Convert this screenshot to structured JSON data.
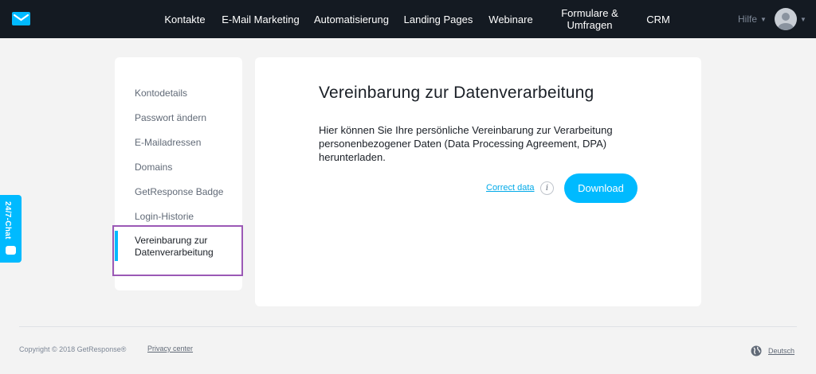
{
  "colors": {
    "topbar": "#141a22",
    "accent": "#00baff",
    "highlight": "#9b59b6",
    "link": "#00a9e8"
  },
  "header": {
    "logo_icon": "envelope-logo-icon",
    "nav": [
      "Kontakte",
      "E-Mail Marketing",
      "Automatisierung",
      "Landing Pages",
      "Webinare",
      "Formulare &\nUmfragen",
      "CRM"
    ],
    "help_label": "Hilfe",
    "avatar_icon": "user-avatar-icon"
  },
  "sidebar": {
    "items": [
      "Kontodetails",
      "Passwort ändern",
      "E-Mailadressen",
      "Domains",
      "GetResponse Badge",
      "Login-Historie"
    ],
    "active_item": "Vereinbarung zur\nDatenverarbeitung"
  },
  "main": {
    "title": "Vereinbarung zur Datenverarbeitung",
    "description": "Hier können Sie Ihre persönliche Vereinbarung zur Verarbeitung personenbezogener Daten (Data Processing Agreement, DPA) herunterladen.",
    "correct_data_link": "Correct data",
    "info_icon": "i",
    "download_button": "Download"
  },
  "chat": {
    "label": "24/7-Chat"
  },
  "footer": {
    "copyright": "Copyright © 2018 GetResponse®",
    "privacy": "Privacy center",
    "language": "Deutsch"
  }
}
